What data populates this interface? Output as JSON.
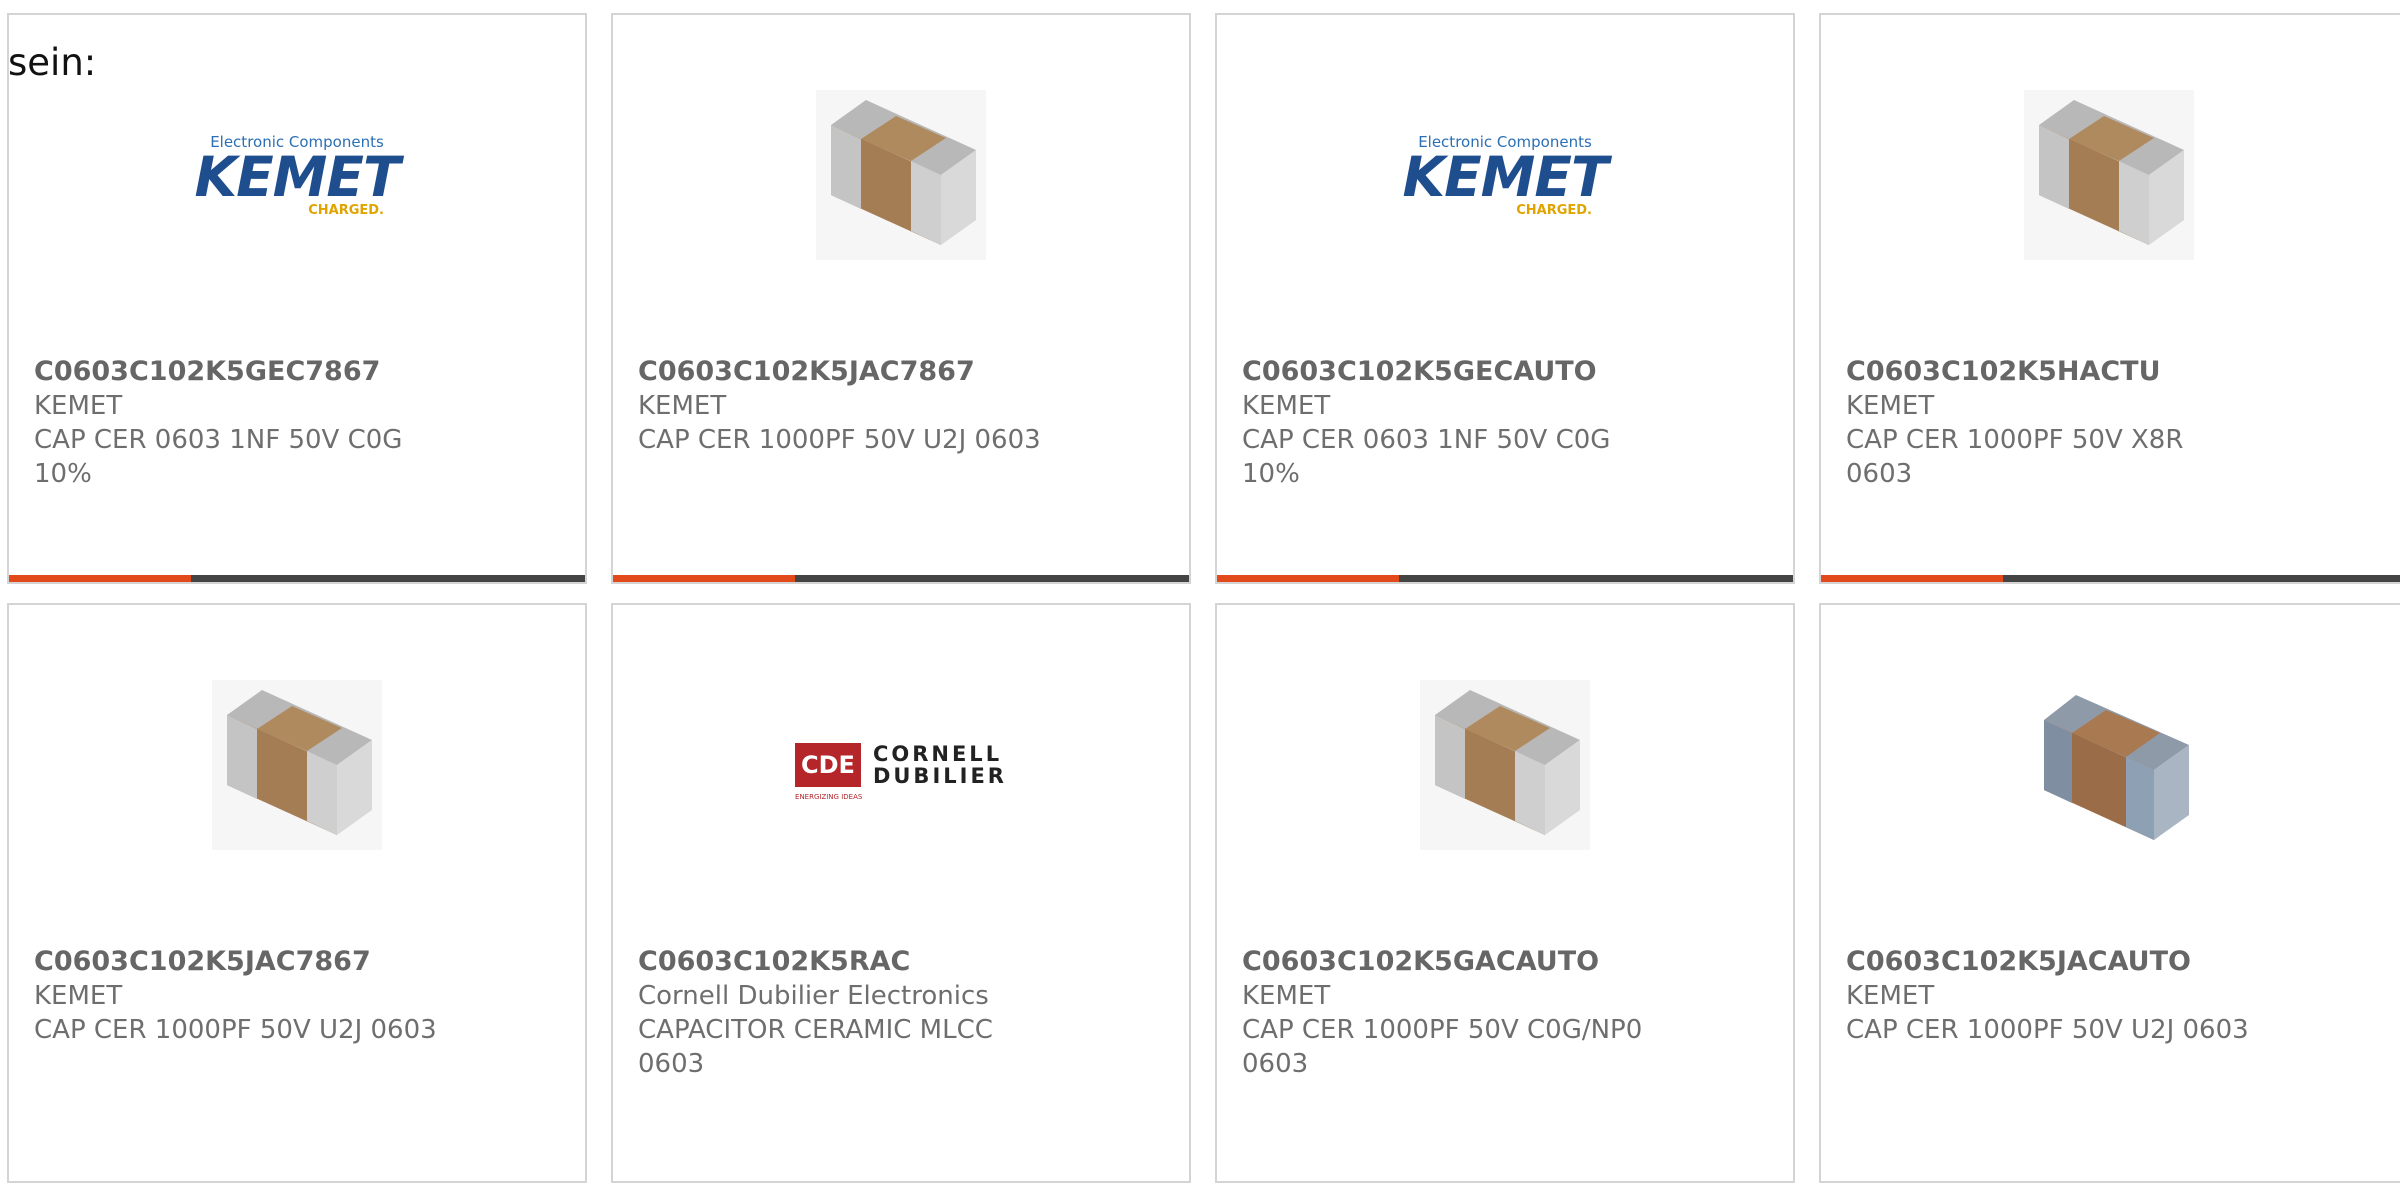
{
  "intro_text": "sein:",
  "products": [
    {
      "part_number": "C0603C102K5GEC7867",
      "manufacturer": "KEMET",
      "description": "CAP CER 0603 1NF 50V C0G 10%",
      "image": "kemet-logo"
    },
    {
      "part_number": "C0603C102K5JAC7867",
      "manufacturer": "KEMET",
      "description": "CAP CER 1000PF 50V U2J 0603",
      "image": "capacitor-chip"
    },
    {
      "part_number": "C0603C102K5GECAUTO",
      "manufacturer": "KEMET",
      "description": "CAP CER 0603 1NF 50V C0G 10%",
      "image": "kemet-logo"
    },
    {
      "part_number": "C0603C102K5HACTU",
      "manufacturer": "KEMET",
      "description": "CAP CER 1000PF 50V X8R 0603",
      "image": "capacitor-chip"
    },
    {
      "part_number": "C0603C102K5JAC7867",
      "manufacturer": "KEMET",
      "description": "CAP CER 1000PF 50V U2J 0603",
      "image": "capacitor-chip"
    },
    {
      "part_number": "C0603C102K5RAC",
      "manufacturer": "Cornell Dubilier Electronics",
      "description": "CAPACITOR CERAMIC MLCC 0603",
      "image": "cde-logo"
    },
    {
      "part_number": "C0603C102K5GACAUTO",
      "manufacturer": "KEMET",
      "description": "CAP CER 1000PF 50V C0G/NP0 0603",
      "image": "capacitor-chip"
    },
    {
      "part_number": "C0603C102K5JACAUTO",
      "manufacturer": "KEMET",
      "description": "CAP CER 1000PF 50V U2J 0603",
      "image": "capacitor-chip-blue"
    }
  ],
  "logos": {
    "kemet": {
      "top": "Electronic Components",
      "main": "KEMET",
      "tagline": "CHARGED."
    },
    "cde": {
      "box": "CDE",
      "line1": "CORNELL",
      "line2": "DUBILIER",
      "sub": "ENERGIZING IDEAS"
    }
  },
  "colors": {
    "accent": "#e24a1c",
    "bar": "#444444",
    "border": "#d4d4d4",
    "text": "#6e6e6e"
  }
}
